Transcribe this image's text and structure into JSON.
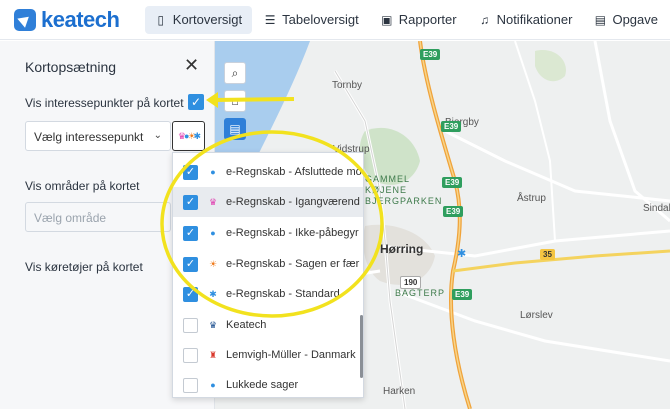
{
  "app": {
    "brand": "keatech"
  },
  "nav": {
    "items": [
      {
        "label": "Kortoversigt",
        "icon": "map-icon"
      },
      {
        "label": "Tabeloversigt",
        "icon": "list-icon"
      },
      {
        "label": "Rapporter",
        "icon": "report-icon"
      },
      {
        "label": "Notifikationer",
        "icon": "bell-icon"
      },
      {
        "label": "Opgave",
        "icon": "clipboard-icon"
      }
    ]
  },
  "panel": {
    "title": "Kortopsætning",
    "poi_label": "Vis interessepunkter på kortet",
    "poi_select": "Vælg interessepunkt",
    "areas_label": "Vis områder på kortet",
    "areas_placeholder": "Vælg område",
    "vehicles_label": "Vis køretøjer på kortet"
  },
  "dropdown": {
    "items": [
      {
        "label": "e-Regnskab - Afsluttede mo",
        "checked": true,
        "glyph": "dot",
        "color": "#2f8fe0"
      },
      {
        "label": "e-Regnskab - Igangværend",
        "checked": true,
        "glyph": "crown",
        "color": "#e03fb0"
      },
      {
        "label": "e-Regnskab - Ikke-påbegyr",
        "checked": true,
        "glyph": "dot",
        "color": "#2f8fe0"
      },
      {
        "label": "e-Regnskab - Sagen er fær",
        "checked": true,
        "glyph": "sun",
        "color": "#f07a1a"
      },
      {
        "label": "e-Regnskab - Standard",
        "checked": true,
        "glyph": "star",
        "color": "#2f8fe0"
      },
      {
        "label": "Keatech",
        "checked": false,
        "glyph": "crown",
        "color": "#1c4f8f"
      },
      {
        "label": "Lemvigh-Müller - Danmark",
        "checked": false,
        "glyph": "person",
        "color": "#d9372b"
      },
      {
        "label": "Lukkede sager",
        "checked": false,
        "glyph": "dot",
        "color": "#2f8fe0"
      }
    ]
  },
  "map": {
    "places": [
      "Tornby",
      "Bjergby",
      "Vidstrup",
      "GAMMEL",
      "KØJENE",
      "BJERGPARKEN",
      "Hørring",
      "BAGTERP",
      "Åstrup",
      "Sindal",
      "Lørslev",
      "Harken"
    ],
    "roads": [
      "E39",
      "E39",
      "E39",
      "E39",
      "E39",
      "35",
      "190"
    ]
  }
}
